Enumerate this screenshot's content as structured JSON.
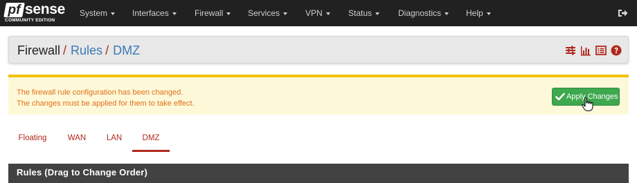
{
  "brand": {
    "logo_pf": "pf",
    "logo_sense": "sense",
    "logo_sub": "COMMUNITY EDITION"
  },
  "nav": {
    "items": [
      {
        "label": "System"
      },
      {
        "label": "Interfaces"
      },
      {
        "label": "Firewall"
      },
      {
        "label": "Services"
      },
      {
        "label": "VPN"
      },
      {
        "label": "Status"
      },
      {
        "label": "Diagnostics"
      },
      {
        "label": "Help"
      }
    ],
    "logout_icon": "sign-out-icon"
  },
  "breadcrumb": {
    "part1": "Firewall",
    "sep": "/",
    "part2": "Rules",
    "part3": "DMZ",
    "icons": [
      "sliders-icon",
      "bar-chart-icon",
      "list-icon",
      "help-icon"
    ]
  },
  "alert": {
    "line1": "The firewall rule configuration has been changed.",
    "line2": "The changes must be applied for them to take effect.",
    "button_label": "Apply Changes",
    "button_icon": "check-icon"
  },
  "tabs": [
    {
      "label": "Floating"
    },
    {
      "label": "WAN"
    },
    {
      "label": "LAN"
    },
    {
      "label": "DMZ",
      "active": true
    }
  ],
  "rules_panel": {
    "heading": "Rules (Drag to Change Order)"
  },
  "colors": {
    "navbar": "#212121",
    "accent_red": "#b0281c",
    "link_blue": "#3a79b7",
    "alert_bg": "#fdf8d8",
    "alert_border": "#f2c200",
    "alert_text": "#e0701a",
    "success_green": "#3ea84f",
    "panel_header": "#424242"
  }
}
